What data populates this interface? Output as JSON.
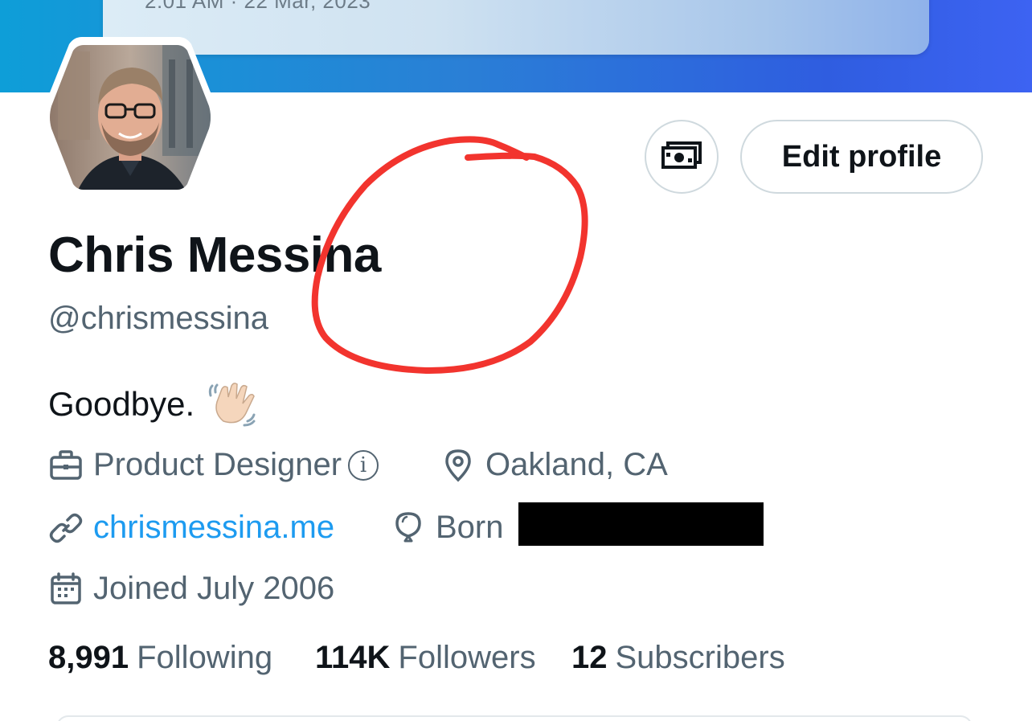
{
  "banner": {
    "timestamp_text": "2:01 AM · 22 Mar, 2023"
  },
  "profile": {
    "display_name": "Chris Messina",
    "handle": "@chrismessina",
    "bio": "Goodbye.",
    "edit_button_label": "Edit profile",
    "meta": {
      "profession": "Product Designer",
      "location": "Oakland, CA",
      "website": "chrismessina.me",
      "birth_label": "Born",
      "joined": "Joined July 2006"
    },
    "stats": {
      "following_count": "8,991",
      "following_label": "Following",
      "followers_count": "114K",
      "followers_label": "Followers",
      "subscribers_count": "12",
      "subscribers_label": "Subscribers"
    }
  },
  "colors": {
    "text_primary": "#0f1419",
    "text_secondary": "#536471",
    "link": "#1d9bf0",
    "border": "#cfd9de",
    "annotation": "#f2342e"
  },
  "icons": {
    "subscriptions": "money-icon",
    "profession": "briefcase-icon",
    "info": "info-icon",
    "location": "location-pin-icon",
    "website": "link-icon",
    "birthday": "balloon-icon",
    "joined": "calendar-icon",
    "bio_emoji": "waving-hand-icon"
  }
}
